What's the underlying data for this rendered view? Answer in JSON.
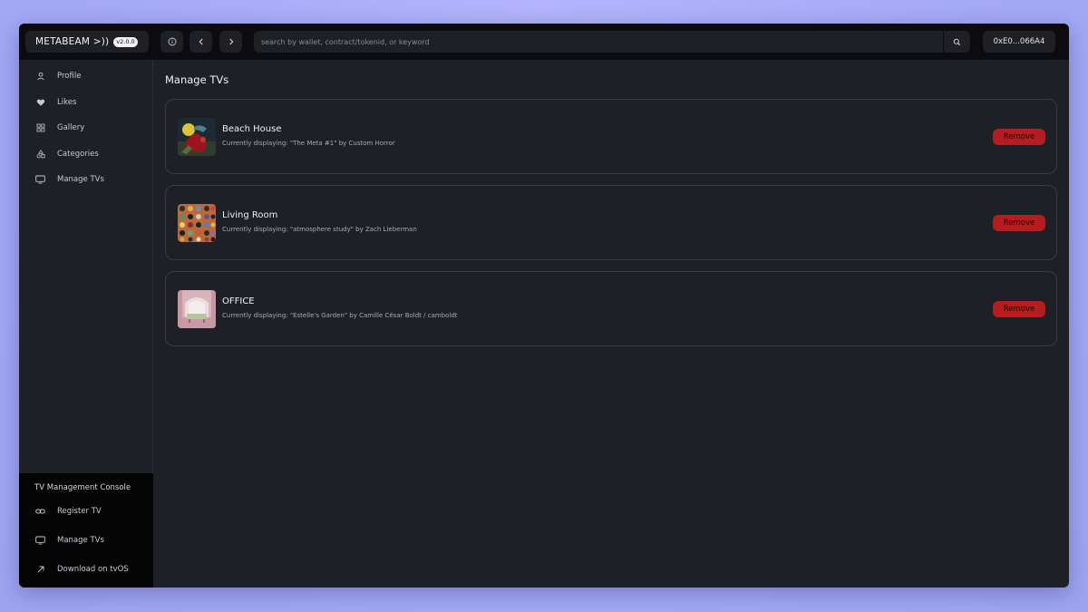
{
  "header": {
    "brand": "METABEAM  >))",
    "version": "v2.0.0",
    "search_placeholder": "search by wallet, contract/tokenid, or keyword",
    "wallet": "0xE0...066A4"
  },
  "sidebar": {
    "items": [
      {
        "label": "Profile",
        "icon": "person-icon"
      },
      {
        "label": "Likes",
        "icon": "heart-icon"
      },
      {
        "label": "Gallery",
        "icon": "grid-icon"
      },
      {
        "label": "Categories",
        "icon": "shapes-icon"
      },
      {
        "label": "Manage TVs",
        "icon": "tv-icon"
      }
    ],
    "console": {
      "title": "TV Management Console",
      "items": [
        {
          "label": "Register TV",
          "icon": "link-icon"
        },
        {
          "label": "Manage TVs",
          "icon": "tv-icon"
        },
        {
          "label": "Download on tvOS",
          "icon": "arrow-up-right-icon"
        }
      ]
    }
  },
  "main": {
    "title": "Manage TVs",
    "tvs": [
      {
        "name": "Beach House",
        "subtitle": "Currently displaying: \"The Meta #1\" by Custom Horror",
        "action": "Remove"
      },
      {
        "name": "Living Room",
        "subtitle": "Currently displaying: \"atmosphere study\" by Zach Lieberman",
        "action": "Remove"
      },
      {
        "name": "OFFICE",
        "subtitle": "Currently displaying: \"Estelle's Garden\" by Camille César Boldt / camboldt",
        "action": "Remove"
      }
    ]
  },
  "colors": {
    "background": "#a6a9f6",
    "panel": "#1f2025",
    "topbar": "#0c0c0e",
    "accent_remove": "#b51d1f"
  }
}
